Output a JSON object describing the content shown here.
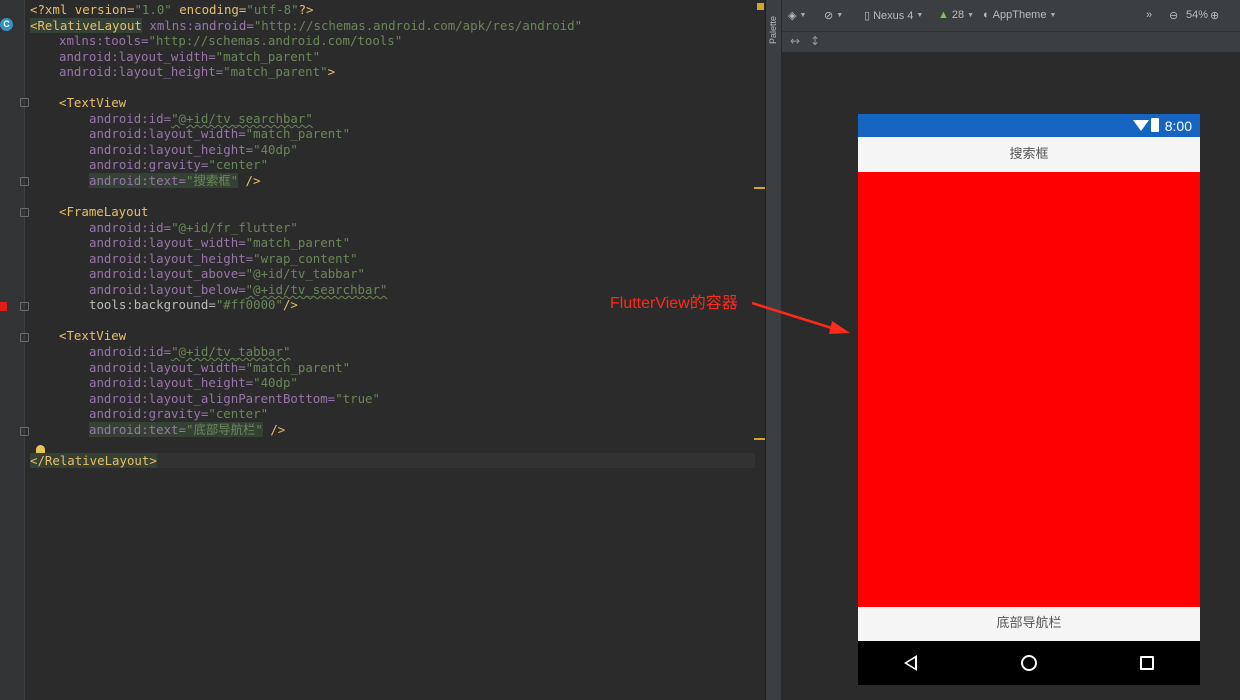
{
  "editor": {
    "lines": {
      "l1_open": "<?xml version=",
      "l1_v1": "\"1.0\"",
      "l1_mid": " encoding=",
      "l1_v2": "\"utf-8\"",
      "l1_close": "?>",
      "l2_tag": "<RelativeLayout",
      "l2_attr": " xmlns:android=",
      "l2_val": "\"http://schemas.android.com/apk/res/android\"",
      "l3_attr": "xmlns:tools=",
      "l3_val": "\"http://schemas.android.com/tools\"",
      "l4_attr": "android:layout_width=",
      "l4_val": "\"match_parent\"",
      "l5_attr": "android:layout_height=",
      "l5_val": "\"match_parent\"",
      "l5_close": ">",
      "tv1_tag": "<TextView",
      "tv1_id_attr": "android:id=",
      "tv1_id_val": "\"@+id/tv_searchbar\"",
      "tv1_w_attr": "android:layout_width=",
      "tv1_w_val": "\"match_parent\"",
      "tv1_h_attr": "android:layout_height=",
      "tv1_h_val": "\"40dp\"",
      "tv1_g_attr": "android:gravity=",
      "tv1_g_val": "\"center\"",
      "tv1_t_attr": "android:text=",
      "tv1_t_val": "\"搜索框\"",
      "tv1_close": " />",
      "fl_tag": "<FrameLayout",
      "fl_id_attr": "android:id=",
      "fl_id_val": "\"@+id/fr_flutter\"",
      "fl_w_attr": "android:layout_width=",
      "fl_w_val": "\"match_parent\"",
      "fl_h_attr": "android:layout_height=",
      "fl_h_val": "\"wrap_content\"",
      "fl_a_attr": "android:layout_above=",
      "fl_a_val": "\"@+id/tv_tabbar\"",
      "fl_b_attr": "android:layout_below=",
      "fl_b_val": "\"@+id/tv_searchbar\"",
      "fl_bg_attr": "tools:background=",
      "fl_bg_val": "\"#ff0000\"",
      "fl_close": "/>",
      "tv2_tag": "<TextView",
      "tv2_id_attr": "android:id=",
      "tv2_id_val": "\"@+id/tv_tabbar\"",
      "tv2_w_attr": "android:layout_width=",
      "tv2_w_val": "\"match_parent\"",
      "tv2_h_attr": "android:layout_height=",
      "tv2_h_val": "\"40dp\"",
      "tv2_ap_attr": "android:layout_alignParentBottom=",
      "tv2_ap_val": "\"true\"",
      "tv2_g_attr": "android:gravity=",
      "tv2_g_val": "\"center\"",
      "tv2_t_attr": "android:text=",
      "tv2_t_val": "\"底部导航栏\"",
      "tv2_close": " />",
      "end_tag": "</RelativeLayout>"
    }
  },
  "palette": {
    "label": "Palette"
  },
  "toolbar": {
    "device": "Nexus 4",
    "api": "28",
    "theme": "AppTheme",
    "zoom": "54%"
  },
  "preview": {
    "time": "8:00",
    "searchbar_text": "搜索框",
    "tabbar_text": "底部导航栏",
    "frame_color": "#ff0000",
    "statusbar_color": "#1565c0"
  },
  "annotation": {
    "text": "FlutterView的容器"
  }
}
